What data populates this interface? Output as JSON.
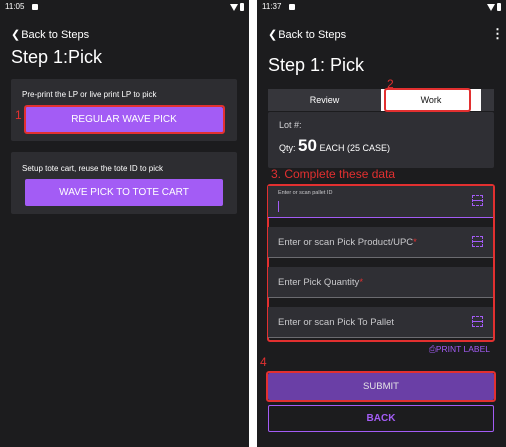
{
  "left": {
    "status": {
      "time": "11:05"
    },
    "back_label": "Back to Steps",
    "title": "Step 1:Pick",
    "card1": {
      "desc": "Pre-print the LP or live print LP to pick",
      "button": "REGULAR WAVE PICK"
    },
    "card2": {
      "desc": "Setup tote cart, reuse the tote ID to pick",
      "button": "WAVE PICK TO TOTE CART"
    },
    "annotation_1": "1"
  },
  "right": {
    "status": {
      "time": "11:37"
    },
    "back_label": "Back to Steps",
    "more_icon": "more-vert-icon",
    "title": "Step 1: Pick",
    "tabs": [
      {
        "label": "Review"
      },
      {
        "label": "Work",
        "active": true
      }
    ],
    "annotation_2": "2",
    "info": {
      "lot_label": "Lot #:",
      "qty_label": "Qty:",
      "qty_value": "50",
      "qty_unit": "EACH (25 CASE)"
    },
    "annotation_3": "3. Complete these data",
    "fields": {
      "pallet_label": "Enter or scan pallet ID",
      "product_placeholder": "Enter or scan Pick Product/UPC",
      "quantity_placeholder": "Enter Pick Quantity",
      "to_pallet_placeholder": "Enter or scan Pick To Pallet",
      "required_mark": "*"
    },
    "print_label": "PRINT LABEL",
    "annotation_4": "4",
    "submit_label": "SUBMIT",
    "back_button": "BACK"
  },
  "colors": {
    "accent": "#a35cf5",
    "annotation": "#e23030",
    "background": "#1c1c1e",
    "card": "#2d2d31"
  }
}
